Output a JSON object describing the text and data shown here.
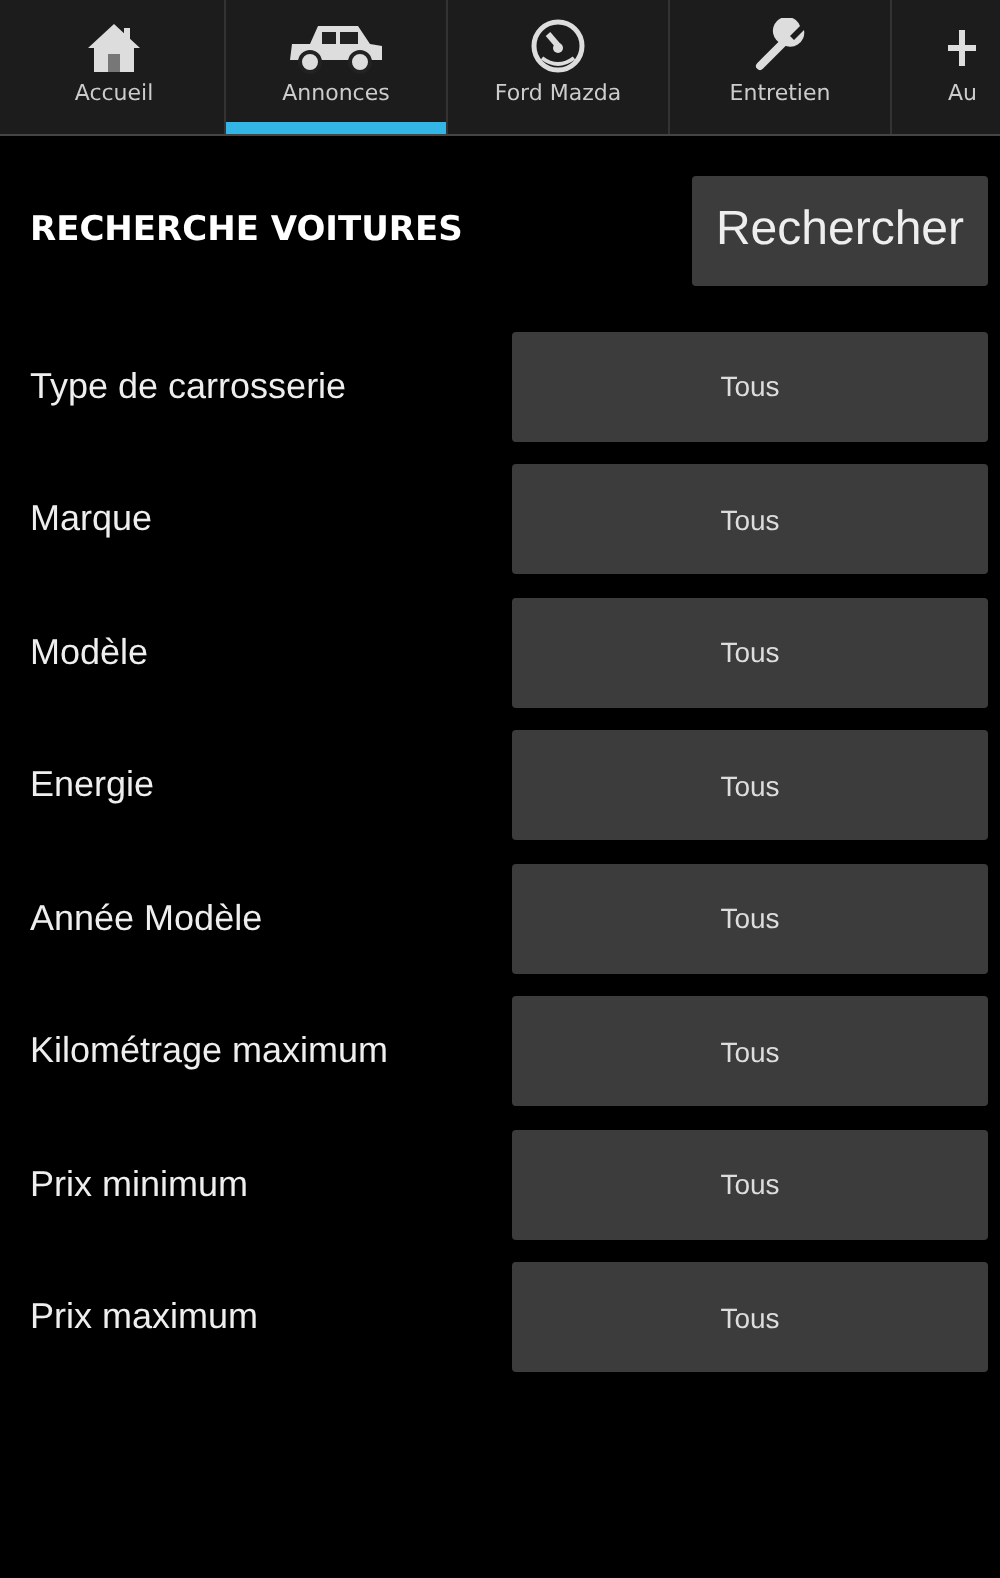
{
  "tabs": [
    {
      "label": "Accueil",
      "selected": false
    },
    {
      "label": "Annonces",
      "selected": true
    },
    {
      "label": "Ford Mazda",
      "selected": false
    },
    {
      "label": "Entretien",
      "selected": false
    },
    {
      "label": "Au",
      "selected": false
    }
  ],
  "title": "RECHERCHE VOITURES",
  "search_button": "Rechercher",
  "filters": [
    {
      "label": "Type de carrosserie",
      "value": "Tous"
    },
    {
      "label": "Marque",
      "value": "Tous"
    },
    {
      "label": "Modèle",
      "value": "Tous"
    },
    {
      "label": "Energie",
      "value": "Tous"
    },
    {
      "label": "Année Modèle",
      "value": "Tous"
    },
    {
      "label": "Kilométrage maximum",
      "value": "Tous"
    },
    {
      "label": "Prix minimum",
      "value": "Tous"
    },
    {
      "label": "Prix maximum",
      "value": "Tous"
    }
  ]
}
